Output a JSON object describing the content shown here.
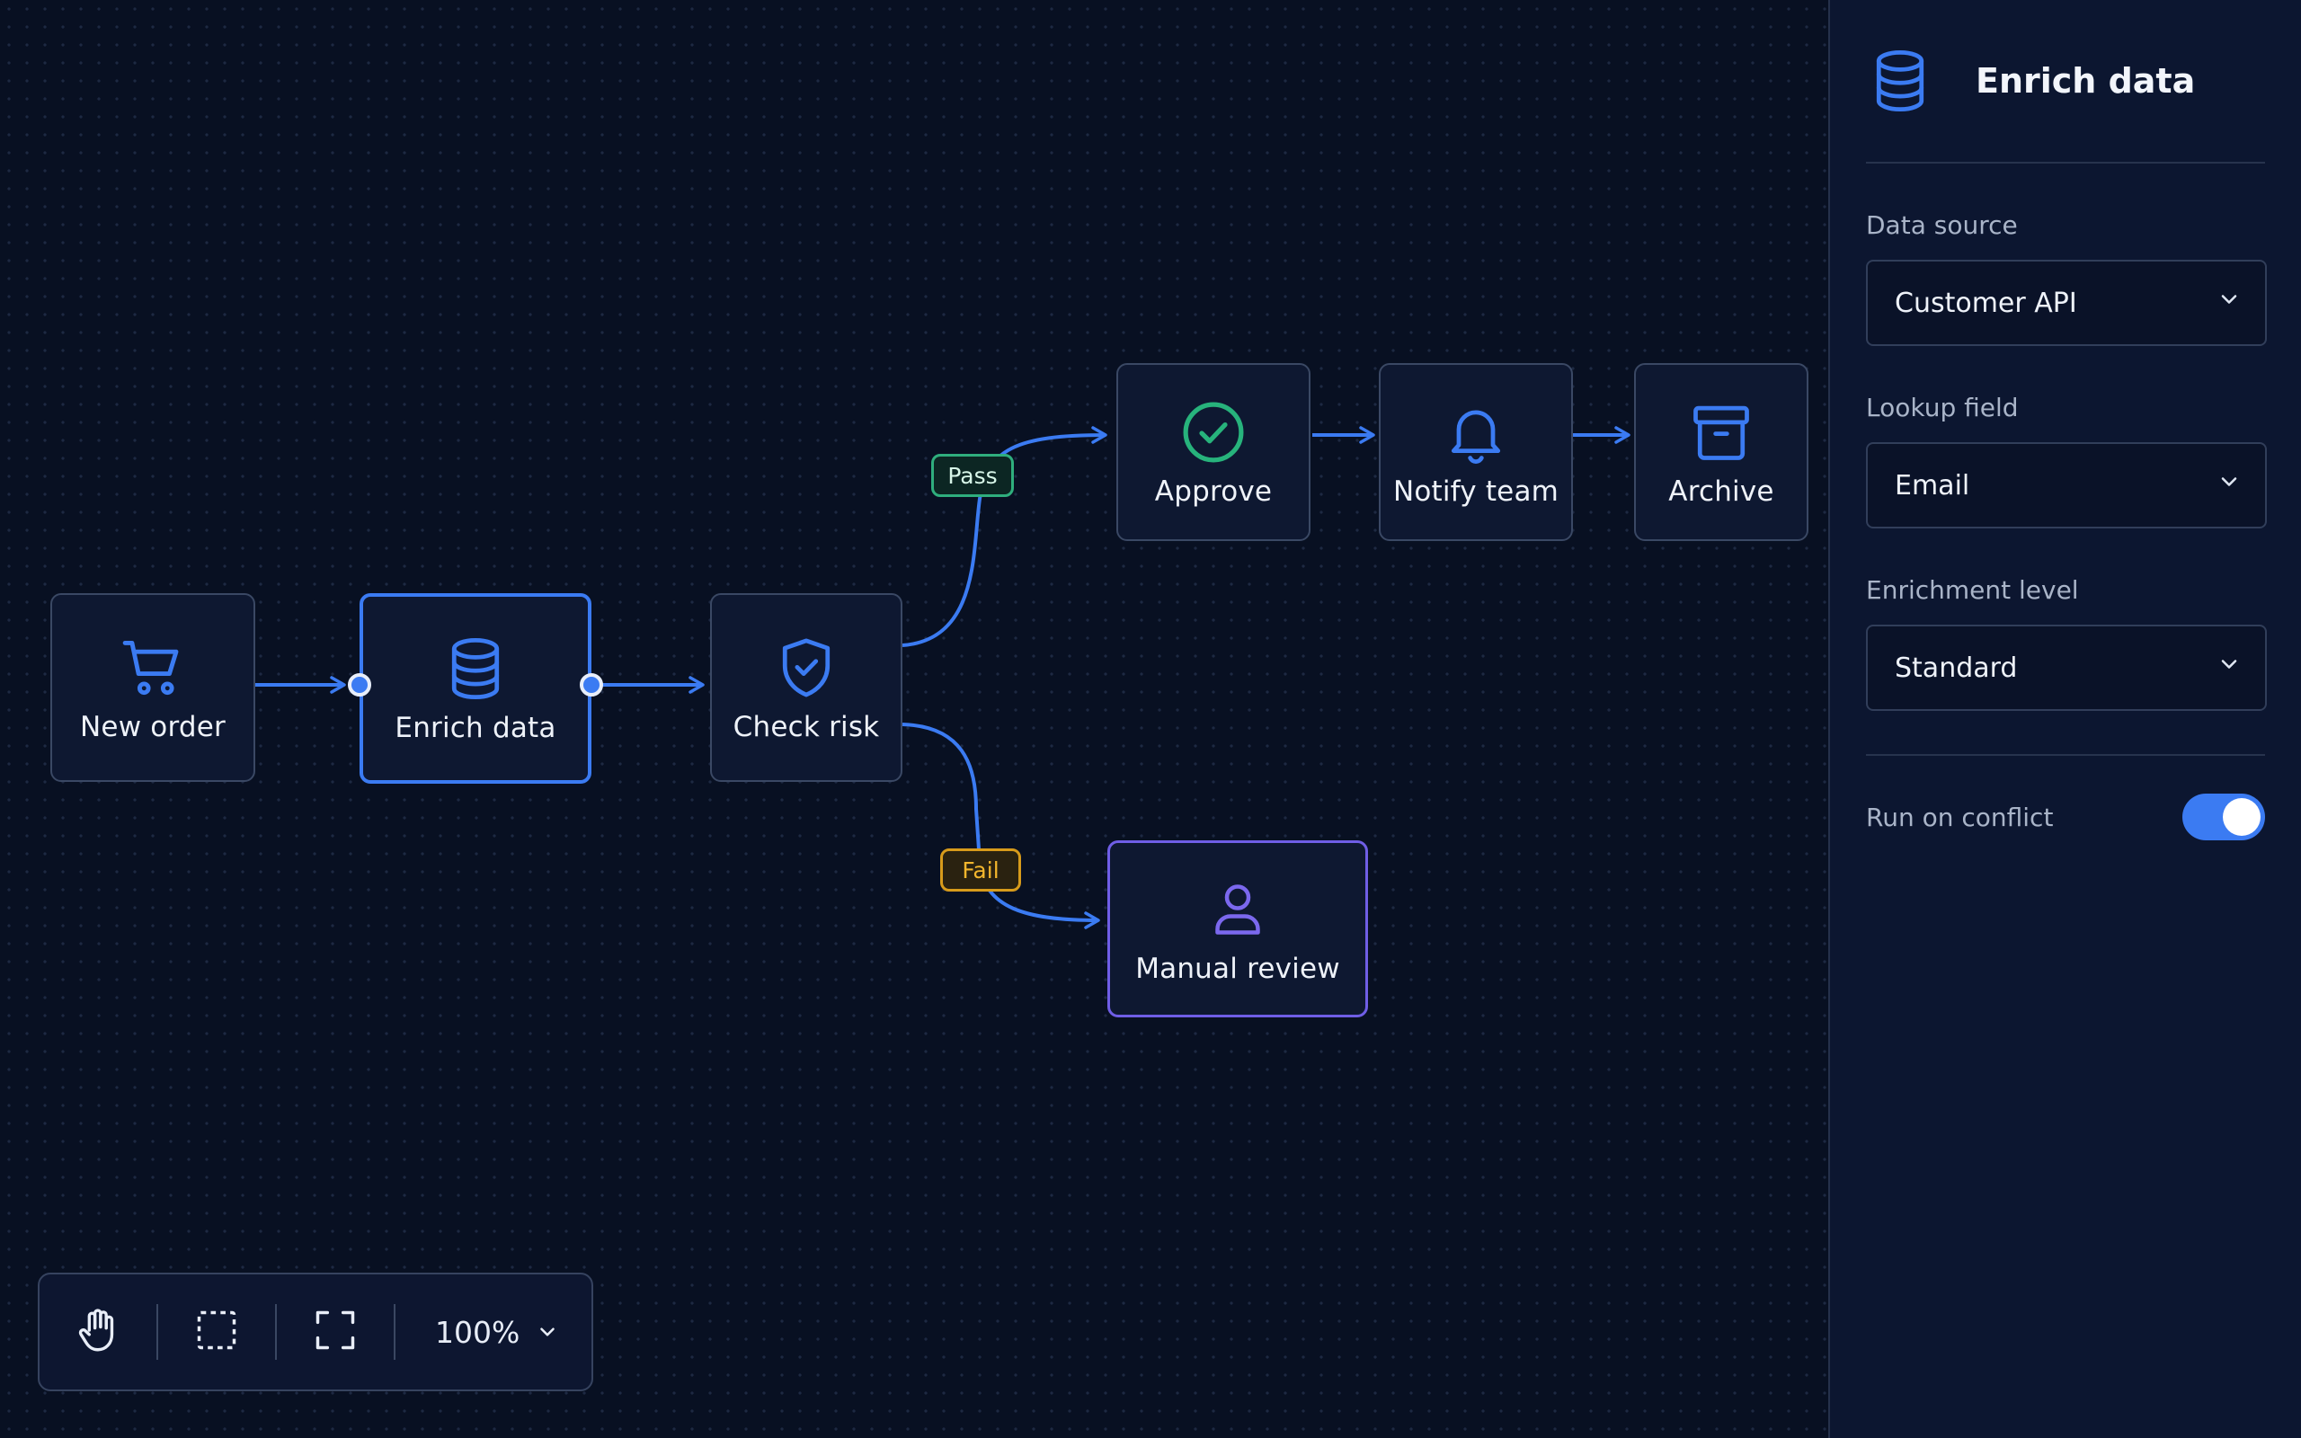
{
  "colors": {
    "accent": "#3b7bf2",
    "pass": "#2fae7d",
    "fail": "#d79b1b",
    "review": "#6f5ee6",
    "background": "#081022"
  },
  "nodes": {
    "new_order": {
      "label": "New order",
      "icon": "shopping-cart-icon"
    },
    "enrich_data": {
      "label": "Enrich data",
      "icon": "database-icon",
      "selected": true
    },
    "check_risk": {
      "label": "Check risk",
      "icon": "shield-check-icon"
    },
    "approve": {
      "label": "Approve",
      "icon": "check-circle-icon"
    },
    "notify_team": {
      "label": "Notify team",
      "icon": "bell-icon"
    },
    "archive": {
      "label": "Archive",
      "icon": "archive-box-icon"
    },
    "manual_review": {
      "label": "Manual review",
      "icon": "user-icon"
    }
  },
  "edge_labels": {
    "pass": "Pass",
    "fail": "Fail"
  },
  "toolbar": {
    "tools": [
      "hand-icon",
      "select-area-icon",
      "fit-view-icon"
    ],
    "zoom": "100%"
  },
  "panel": {
    "title": "Enrich data",
    "icon": "database-icon",
    "fields": [
      {
        "label": "Data source",
        "value": "Customer API"
      },
      {
        "label": "Lookup field",
        "value": "Email"
      },
      {
        "label": "Enrichment level",
        "value": "Standard"
      }
    ],
    "toggle": {
      "label": "Run on conflict",
      "on": true
    }
  }
}
